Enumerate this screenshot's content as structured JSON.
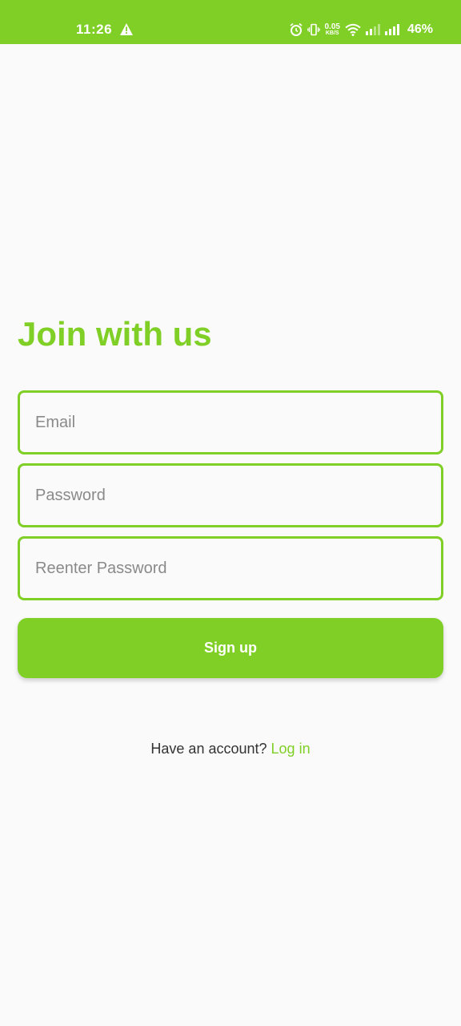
{
  "status_bar": {
    "time": "11:26",
    "net_speed_value": "0.05",
    "net_speed_unit": "KB/S",
    "battery": "46%"
  },
  "form": {
    "title": "Join with us",
    "email_placeholder": "Email",
    "password_placeholder": "Password",
    "reenter_placeholder": "Reenter Password",
    "signup_label": "Sign up"
  },
  "footer": {
    "prompt": "Have an account?",
    "login_label": "Log in"
  },
  "colors": {
    "accent": "#80cf26",
    "background": "#fafafa"
  }
}
